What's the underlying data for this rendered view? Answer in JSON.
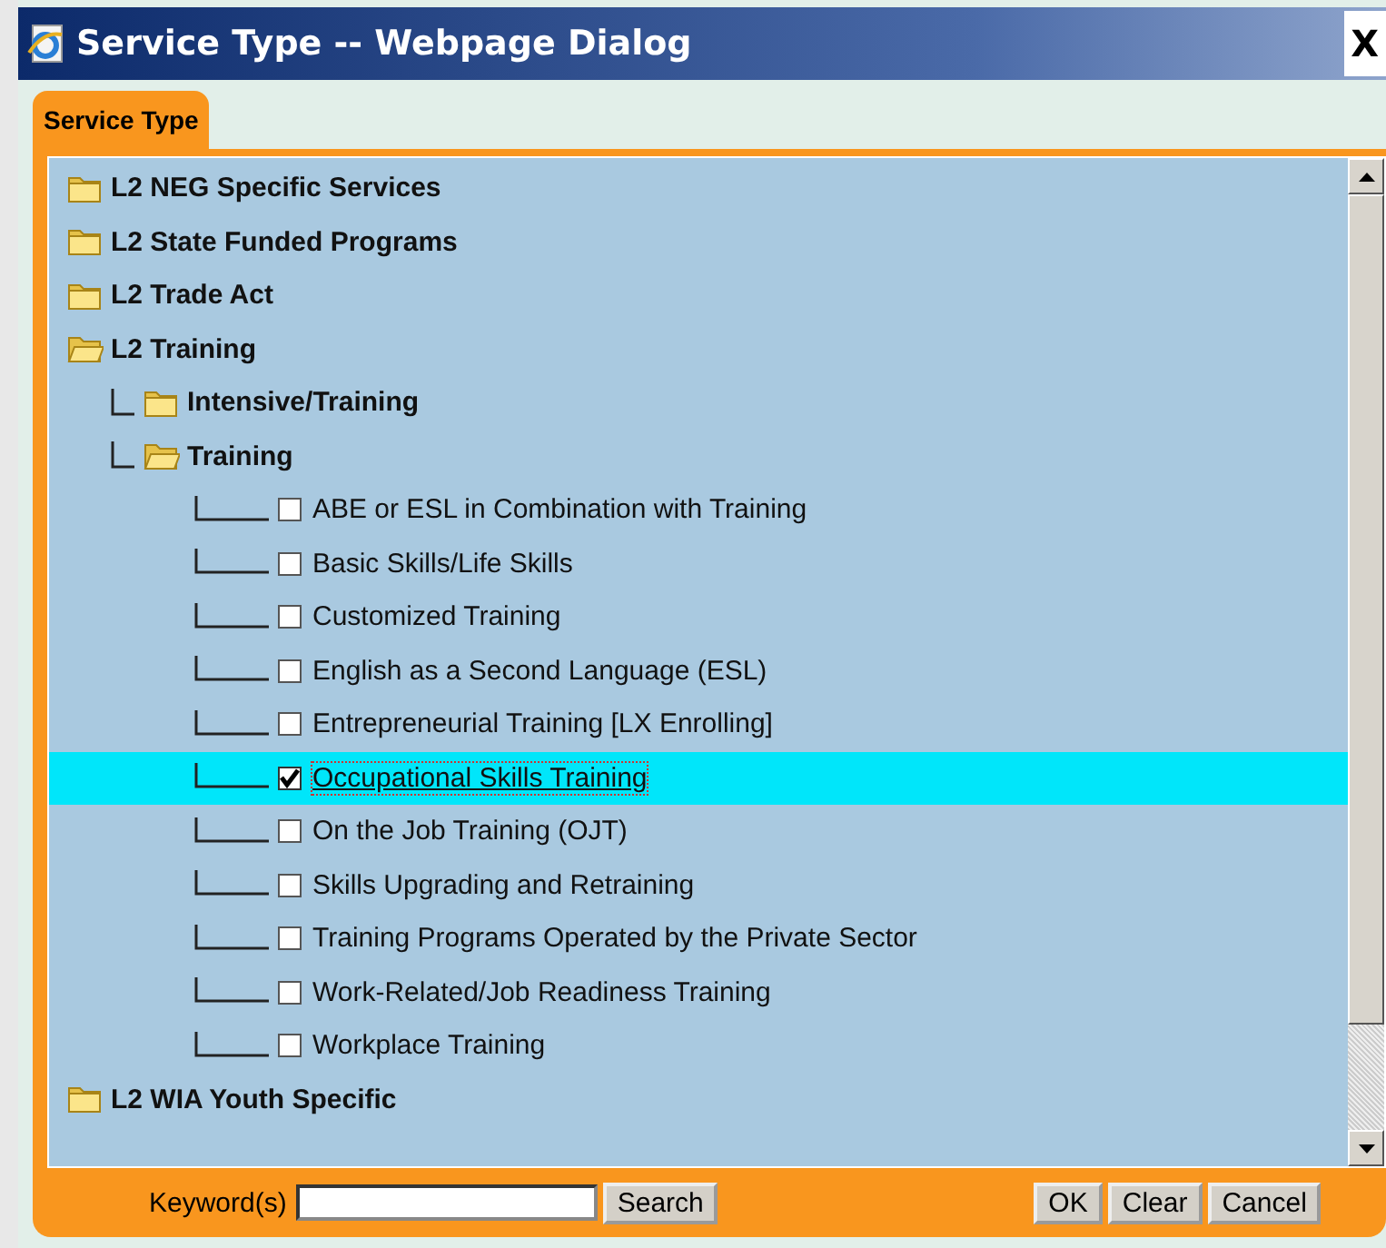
{
  "window": {
    "title": "Service Type -- Webpage Dialog",
    "close": "X"
  },
  "tabs": [
    {
      "label": "Service Type",
      "selected": true
    }
  ],
  "tree": [
    {
      "kind": "folder",
      "label": "L2 NEG Specific Services",
      "expanded": false
    },
    {
      "kind": "folder",
      "label": "L2 State Funded Programs",
      "expanded": false
    },
    {
      "kind": "folder",
      "label": "L2 Trade Act",
      "expanded": false
    },
    {
      "kind": "folder",
      "label": "L2 Training",
      "expanded": true,
      "children": [
        {
          "kind": "folder",
          "label": "Intensive/Training",
          "expanded": false
        },
        {
          "kind": "folder",
          "label": "Training",
          "expanded": true,
          "children": [
            {
              "kind": "checkbox",
              "label": "ABE or ESL in Combination with Training",
              "checked": false,
              "selected": false
            },
            {
              "kind": "checkbox",
              "label": "Basic Skills/Life Skills",
              "checked": false,
              "selected": false
            },
            {
              "kind": "checkbox",
              "label": "Customized Training",
              "checked": false,
              "selected": false
            },
            {
              "kind": "checkbox",
              "label": "English as a Second Language (ESL)",
              "checked": false,
              "selected": false
            },
            {
              "kind": "checkbox",
              "label": "Entrepreneurial Training [LX Enrolling]",
              "checked": false,
              "selected": false
            },
            {
              "kind": "checkbox",
              "label": "Occupational Skills Training",
              "checked": true,
              "selected": true
            },
            {
              "kind": "checkbox",
              "label": "On the Job Training (OJT)",
              "checked": false,
              "selected": false
            },
            {
              "kind": "checkbox",
              "label": "Skills Upgrading and Retraining",
              "checked": false,
              "selected": false
            },
            {
              "kind": "checkbox",
              "label": "Training Programs Operated by the Private Sector",
              "checked": false,
              "selected": false
            },
            {
              "kind": "checkbox",
              "label": "Work-Related/Job Readiness Training",
              "checked": false,
              "selected": false
            },
            {
              "kind": "checkbox",
              "label": "Workplace Training",
              "checked": false,
              "selected": false
            }
          ]
        }
      ]
    },
    {
      "kind": "folder",
      "label": "L2 WIA Youth Specific",
      "expanded": false
    }
  ],
  "footer": {
    "keyword_label": "Keyword(s)",
    "search_button": "Search",
    "buttons": [
      "OK",
      "Clear",
      "Cancel"
    ]
  }
}
